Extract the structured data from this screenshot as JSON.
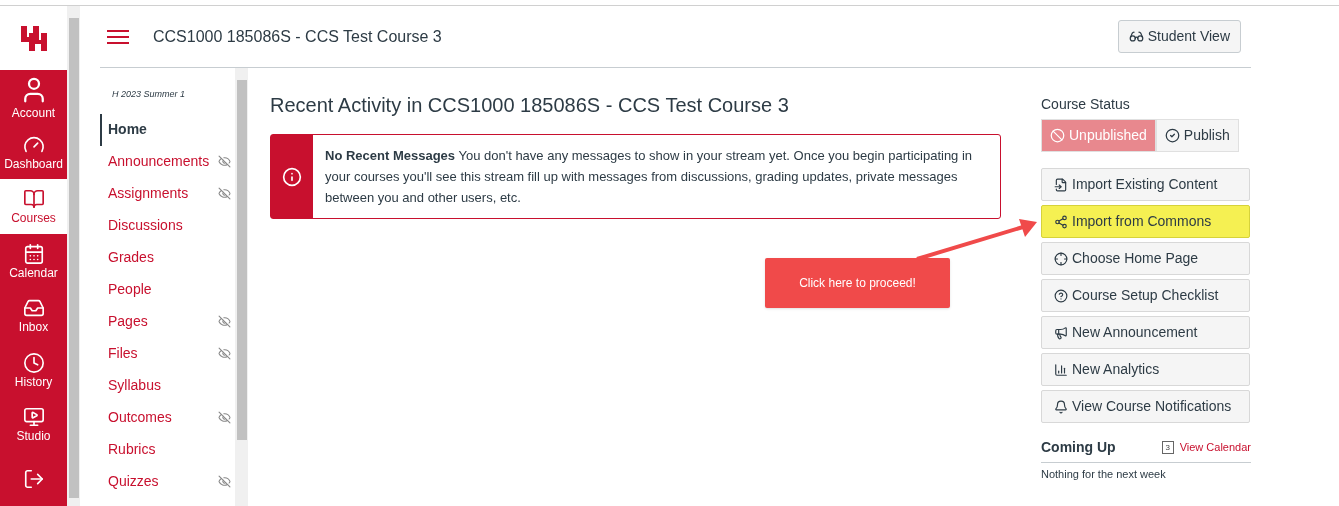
{
  "global_nav": [
    {
      "kind": "account",
      "label": "Account",
      "selected": false
    },
    {
      "kind": "dashboard",
      "label": "Dashboard",
      "selected": false
    },
    {
      "kind": "courses",
      "label": "Courses",
      "selected": true
    },
    {
      "kind": "calendar",
      "label": "Calendar",
      "selected": false
    },
    {
      "kind": "inbox",
      "label": "Inbox",
      "selected": false
    },
    {
      "kind": "history",
      "label": "History",
      "selected": false
    },
    {
      "kind": "studio",
      "label": "Studio",
      "selected": false
    },
    {
      "kind": "commons",
      "selected": false
    }
  ],
  "header": {
    "title": "CCS1000 185086S - CCS Test Course 3",
    "student_view": "Student View"
  },
  "course_nav": {
    "term": "H 2023 Summer 1",
    "items": [
      {
        "label": "Home",
        "selected": true,
        "hidden": false
      },
      {
        "label": "Announcements",
        "selected": false,
        "hidden": true
      },
      {
        "label": "Assignments",
        "selected": false,
        "hidden": true
      },
      {
        "label": "Discussions",
        "selected": false,
        "hidden": false
      },
      {
        "label": "Grades",
        "selected": false,
        "hidden": false
      },
      {
        "label": "People",
        "selected": false,
        "hidden": false
      },
      {
        "label": "Pages",
        "selected": false,
        "hidden": true
      },
      {
        "label": "Files",
        "selected": false,
        "hidden": true
      },
      {
        "label": "Syllabus",
        "selected": false,
        "hidden": false
      },
      {
        "label": "Outcomes",
        "selected": false,
        "hidden": true
      },
      {
        "label": "Rubrics",
        "selected": false,
        "hidden": false
      },
      {
        "label": "Quizzes",
        "selected": false,
        "hidden": true
      }
    ]
  },
  "main": {
    "heading": "Recent Activity in CCS1000 185086S - CCS Test Course 3",
    "alert": "**No Recent Messages**  You don't have any messages to show in your stream yet. Once you begin participating in your courses you'll see this stream fill up with messages from discussions, grading updates, private messages between you and other users, etc."
  },
  "sidebar": {
    "status_title": "Course Status",
    "status": [
      {
        "label": "Unpublished",
        "selected": true,
        "kind": "unpublished"
      },
      {
        "label": "Publish",
        "selected": false,
        "kind": "publish"
      }
    ],
    "actions": [
      {
        "kind": "import",
        "label": "Import Existing Content",
        "highlighted": false
      },
      {
        "kind": "commons",
        "label": "Import from Commons",
        "highlighted": true
      },
      {
        "kind": "home",
        "label": "Choose Home Page",
        "highlighted": false
      },
      {
        "kind": "checklist",
        "label": "Course Setup Checklist",
        "highlighted": false
      },
      {
        "kind": "announcement",
        "label": "New Announcement",
        "highlighted": false
      },
      {
        "kind": "analytics",
        "label": "New Analytics",
        "highlighted": false
      },
      {
        "kind": "notifications",
        "label": "View Course Notifications",
        "highlighted": false
      }
    ],
    "coming_up": {
      "title": "Coming Up",
      "link": "View Calendar",
      "calendar_day": "3",
      "empty": "Nothing for the next week"
    }
  },
  "callout": {
    "text": "Click here to proceed!"
  }
}
